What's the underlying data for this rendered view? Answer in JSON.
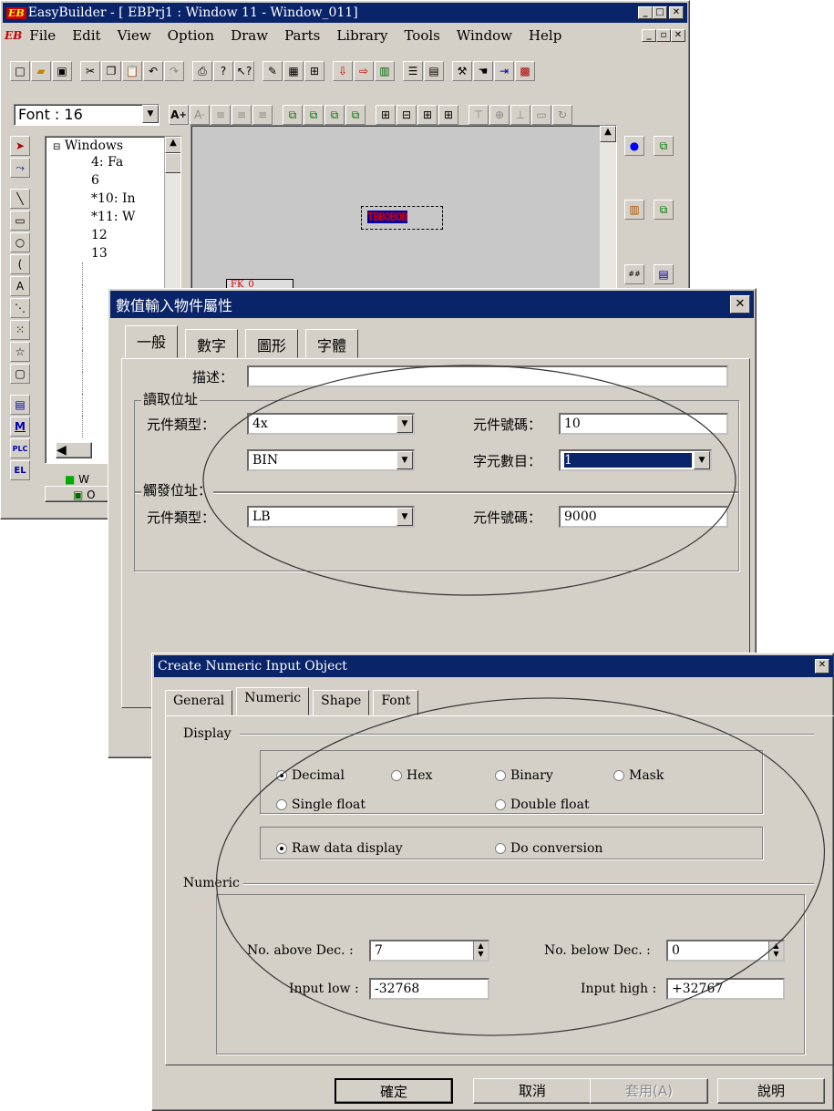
{
  "main_window": {
    "title": "EasyBuilder - [  EBPrj1  :  Window  11  -  Window_011]",
    "logo": "EB",
    "menu": [
      "File",
      "Edit",
      "View",
      "Option",
      "Draw",
      "Parts",
      "Library",
      "Tools",
      "Window",
      "Help"
    ],
    "font_label": "Font : 16",
    "tree": {
      "root": "Windows",
      "items": [
        "4: Fa",
        "6",
        "*10: In",
        "*11: W",
        "12",
        "13"
      ]
    },
    "canvas_object_text": "TBBOBOB",
    "canvas_obj2_text": "FK_0",
    "bottom_tab": "W",
    "bottom_tab2": "O"
  },
  "dialog_zh": {
    "title": "數值輸入物件屬性",
    "close": "✕",
    "tabs": [
      "一般",
      "數字",
      "圖形",
      "字體"
    ],
    "desc_label": "描述：",
    "desc_value": "",
    "read_group": "讀取位址",
    "dev_type_label": "元件類型：",
    "dev_type_value": "4x",
    "dev_num_label": "元件號碼：",
    "dev_num_value": "10",
    "format_value": "BIN",
    "word_count_label": "字元數目：",
    "word_count_value": "1",
    "trigger_group": "觸發位址：",
    "trig_type_label": "元件類型：",
    "trig_type_value": "LB",
    "trig_num_label": "元件號碼：",
    "trig_num_value": "9000"
  },
  "dialog_en": {
    "title": "Create Numeric Input Object",
    "close": "✕",
    "tabs": [
      "General",
      "Numeric",
      "Shape",
      "Font"
    ],
    "display_group": "Display",
    "radios_fmt": [
      "Decimal",
      "Hex",
      "Binary",
      "Mask",
      "Single float",
      "Double float"
    ],
    "radio_selected": "Decimal",
    "radios_conv": [
      "Raw data display",
      "Do conversion"
    ],
    "conv_selected": "Raw data display",
    "numeric_group": "Numeric",
    "above_label": "No. above Dec. :",
    "above_value": "7",
    "below_label": "No. below Dec. :",
    "below_value": "0",
    "low_label": "Input low :",
    "low_value": "-32768",
    "high_label": "Input high :",
    "high_value": "+32767",
    "buttons": [
      "確定",
      "取消",
      "套用(A)",
      "說明"
    ]
  }
}
